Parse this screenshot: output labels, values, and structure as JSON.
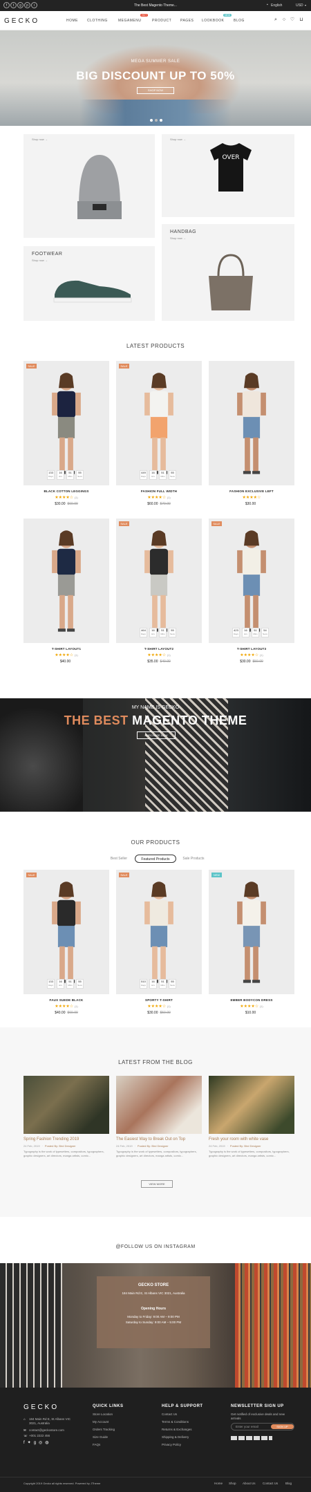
{
  "topbar": {
    "social": [
      "f",
      "t",
      "g",
      "p",
      "i"
    ],
    "promo": "The Best Magento Theme...",
    "language": "English",
    "currency": "USD"
  },
  "header": {
    "logo": "GECKO",
    "nav": [
      {
        "label": "HOME",
        "badge": ""
      },
      {
        "label": "CLOTHING",
        "badge": ""
      },
      {
        "label": "MEGAMENU",
        "badge": "HOT"
      },
      {
        "label": "PRODUCT",
        "badge": ""
      },
      {
        "label": "PAGES",
        "badge": ""
      },
      {
        "label": "LOOKBOOK",
        "badge": "NEW"
      },
      {
        "label": "BLOG",
        "badge": ""
      }
    ],
    "icons": [
      "search-icon",
      "user-icon",
      "heart-icon",
      "cart-icon"
    ]
  },
  "hero": {
    "subtitle": "MEGA SUMMER SALE",
    "title": "BIG DISCOUNT UP TO 50%",
    "button": "SHOP NOW"
  },
  "categories": [
    {
      "label": "",
      "link": "Shop now →"
    },
    {
      "label": "",
      "link": "Shop now →"
    },
    {
      "label": "HANDBAG",
      "link": "Shop now →"
    },
    {
      "label": "FOOTWEAR",
      "link": "Shop now →"
    }
  ],
  "latest": {
    "title": "LATEST PRODUCTS",
    "products": [
      {
        "name": "BLACK COTTON LEGGINGS",
        "price": "$30.00",
        "old": "$60.00",
        "reviews": "(1)",
        "sale": "SALE",
        "countdown": [
          "133",
          "16",
          "51",
          "55"
        ]
      },
      {
        "name": "FASHION FULL WIDTH",
        "price": "$60.00",
        "old": "$70.00",
        "reviews": "(1)",
        "sale": "SALE",
        "countdown": [
          "449",
          "16",
          "51",
          "55"
        ]
      },
      {
        "name": "FASHION EXCLUSIVE LEFT",
        "price": "$30.00",
        "old": "",
        "reviews": "",
        "sale": "",
        "countdown": []
      },
      {
        "name": "T-SHIRT LAYOUT1",
        "price": "$40.00",
        "old": "",
        "reviews": "(1)",
        "sale": "",
        "countdown": []
      },
      {
        "name": "T-SHIRT LAYOUT2",
        "price": "$35.00",
        "old": "$40.00",
        "reviews": "(1)",
        "sale": "SALE",
        "countdown": [
          "464",
          "16",
          "51",
          "55"
        ]
      },
      {
        "name": "T-SHIRT LAYOUT3",
        "price": "$30.00",
        "old": "$50.00",
        "reviews": "(1)",
        "sale": "SALE",
        "countdown": [
          "423",
          "16",
          "51",
          "54"
        ]
      }
    ],
    "countdown_units": [
      "Days",
      "Hrs",
      "Mins",
      "Secs"
    ]
  },
  "banner": {
    "subtitle": "MY NAME IS GECKO",
    "title_a": "THE BEST ",
    "title_b": "MAGENTO THEME",
    "button": "PURCHASE NOW"
  },
  "ours": {
    "title": "OUR PRODUCTS",
    "tabs": [
      "Best Seller",
      "Featured Products",
      "Sale Products"
    ],
    "products": [
      {
        "name": "FAUX SUEDE BLACK",
        "price": "$40.00",
        "old": "$60.00",
        "reviews": "(1)",
        "sale": "SALE",
        "countdown": [
          "133",
          "16",
          "51",
          "55"
        ]
      },
      {
        "name": "SPORTY T-SHIRT",
        "price": "$30.00",
        "old": "$50.00",
        "reviews": "(1)",
        "sale": "SALE",
        "countdown": [
          "510",
          "16",
          "51",
          "55"
        ]
      },
      {
        "name": "EMBER BODYCON DRESS",
        "price": "$10.00",
        "old": "",
        "reviews": "(1)",
        "sale": "NEW",
        "countdown": []
      }
    ]
  },
  "blog": {
    "title": "LATEST FROM THE BLOG",
    "posts": [
      {
        "title": "Spring Fashion Trending 2019",
        "date": "24 Feb, 2019",
        "author": "Posted By: Bird Designer",
        "excerpt": "Typography is the work of typesetters, compositors, typographers, graphic designers, art directors, manga artists, comic..."
      },
      {
        "title": "The Easiest Way to Break Out on Top",
        "date": "24 Feb, 2019",
        "author": "Posted By: Bird Designer",
        "excerpt": "Typography is the work of typesetters, compositors, typographers, graphic designers, art directors, manga artists, comic..."
      },
      {
        "title": "Fresh your room with white vase",
        "date": "24 Feb, 2019",
        "author": "Posted By: Bird Designer",
        "excerpt": "Typography is the work of typesetters, compositors, typographers, graphic designers, art directors, manga artists, comic..."
      }
    ],
    "button": "VIEW MORE"
  },
  "instagram": "@FOLLOW US ON INSTAGRAM",
  "store": {
    "title": "GECKO STORE",
    "address": "184 Main Rd E, St Albans VIC 3021, Australia",
    "hours_title": "Opening Hours",
    "hours1": "Monday to Friday: 9:00 AM – 9:00 PM",
    "hours2": "Saturday to Sunday: 9:00 AM – 5:00 PM"
  },
  "footer": {
    "logo": "GECKO",
    "address": "184 Main Rd E, St Albans VIC 3021, Australia",
    "email": "contact@geckostore.com",
    "phone": "+001 2222 456",
    "quick_title": "QUICK LINKS",
    "quick": [
      "Store Location",
      "My Account",
      "Orders Tracking",
      "Size Guide",
      "FAQs"
    ],
    "help_title": "HELP & SUPPORT",
    "help": [
      "Contact Us",
      "Terms & Conditions",
      "Returns & Exchanges",
      "Shipping & Delivery",
      "Privacy Policy"
    ],
    "news_title": "NEWSLETTER SIGN UP",
    "news_text": "Get notified of exclusive deals and new arrivals",
    "email_placeholder": "Enter your email",
    "signup": "SIGN UP",
    "copyright": "Copyright 2019 Gecko all rights reserved. Powered by JTheme",
    "bottom_links": [
      "Home",
      "Shop",
      "About Us",
      "Contact Us",
      "Blog"
    ]
  },
  "colors": {
    "accent": "#e08b5d",
    "hot": "#e8503a",
    "new": "#5cc4c8",
    "star": "#f0a500",
    "blogtitle": "#a87a50"
  }
}
